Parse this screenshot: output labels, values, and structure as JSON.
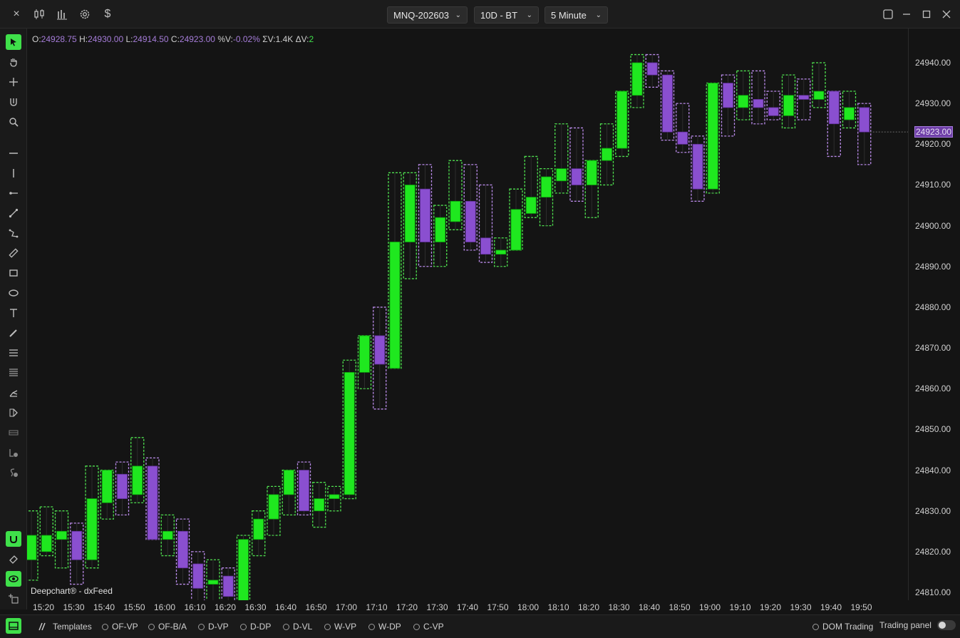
{
  "toolbar": {
    "close_icon": "×",
    "dollar_icon": "$",
    "symbol": "MNQ-202603",
    "period": "10D - BT",
    "interval": "5 Minute"
  },
  "ohlc": {
    "o_label": "O:",
    "o_value": "24928.75",
    "h_label": "H:",
    "h_value": "24930.00",
    "l_label": "L:",
    "l_value": "24914.50",
    "c_label": "C:",
    "c_value": "24923.00",
    "pv_label": "%V:",
    "pv_value": "-0.02%",
    "sv_label": "ΣV:",
    "sv_value": "1.4K",
    "dv_label": "ΔV:",
    "dv_value": "2"
  },
  "watermark": "Deepchart® - dxFeed",
  "current_price": "24923.00",
  "colors": {
    "up": "#1fe81f",
    "down": "#8a4fd0",
    "accent": "#3fe04a"
  },
  "price_ticks": [
    "24940.00",
    "24930.00",
    "24920.00",
    "24910.00",
    "24900.00",
    "24890.00",
    "24880.00",
    "24870.00",
    "24860.00",
    "24850.00",
    "24840.00",
    "24830.00",
    "24820.00",
    "24810.00"
  ],
  "time_ticks": [
    "15:20",
    "15:30",
    "15:40",
    "15:50",
    "16:00",
    "16:10",
    "16:20",
    "16:30",
    "16:40",
    "16:50",
    "17:00",
    "17:10",
    "17:20",
    "17:30",
    "17:40",
    "17:50",
    "18:00",
    "18:10",
    "18:20",
    "18:30",
    "18:40",
    "18:50",
    "19:00",
    "19:10",
    "19:20",
    "19:30",
    "19:40",
    "19:50"
  ],
  "bottom": {
    "templates": "Templates",
    "options": [
      "OF-VP",
      "OF-B/A",
      "D-VP",
      "D-DP",
      "D-VL",
      "W-VP",
      "W-DP",
      "C-VP"
    ],
    "dom_trading": "DOM Trading",
    "trading_panel": "Trading panel"
  },
  "chart_data": {
    "type": "candlestick",
    "symbol": "MNQ-202603",
    "interval": "5 Minute",
    "y_range": [
      24808,
      24948
    ],
    "candles": [
      {
        "t": "15:15",
        "o": 24818,
        "c": 24824,
        "h": 24830,
        "l": 24813
      },
      {
        "t": "15:17",
        "o": 24820,
        "c": 24824,
        "h": 24831,
        "l": 24819
      },
      {
        "t": "15:20",
        "o": 24823,
        "c": 24825,
        "h": 24830,
        "l": 24816
      },
      {
        "t": "15:25",
        "o": 24825,
        "c": 24818,
        "h": 24827,
        "l": 24812
      },
      {
        "t": "15:30",
        "o": 24818,
        "c": 24833,
        "h": 24841,
        "l": 24816
      },
      {
        "t": "15:35",
        "o": 24832,
        "c": 24840,
        "h": 24840,
        "l": 24828
      },
      {
        "t": "15:40",
        "o": 24839,
        "c": 24833,
        "h": 24842,
        "l": 24829
      },
      {
        "t": "15:45",
        "o": 24834,
        "c": 24841,
        "h": 24848,
        "l": 24832
      },
      {
        "t": "15:50",
        "o": 24841,
        "c": 24823,
        "h": 24843,
        "l": 24823
      },
      {
        "t": "15:55",
        "o": 24823,
        "c": 24825,
        "h": 24829,
        "l": 24819
      },
      {
        "t": "16:00",
        "o": 24825,
        "c": 24816,
        "h": 24828,
        "l": 24812
      },
      {
        "t": "16:05",
        "o": 24817,
        "c": 24811,
        "h": 24820,
        "l": 24806
      },
      {
        "t": "16:10",
        "o": 24812,
        "c": 24813,
        "h": 24818,
        "l": 24805
      },
      {
        "t": "16:15",
        "o": 24814,
        "c": 24809,
        "h": 24816,
        "l": 24804
      },
      {
        "t": "16:20",
        "o": 24807,
        "c": 24823,
        "h": 24824,
        "l": 24804
      },
      {
        "t": "16:25",
        "o": 24823,
        "c": 24828,
        "h": 24830,
        "l": 24819
      },
      {
        "t": "16:30",
        "o": 24828,
        "c": 24834,
        "h": 24836,
        "l": 24824
      },
      {
        "t": "16:35",
        "o": 24834,
        "c": 24840,
        "h": 24840,
        "l": 24829
      },
      {
        "t": "16:40",
        "o": 24840,
        "c": 24830,
        "h": 24842,
        "l": 24829
      },
      {
        "t": "16:45",
        "o": 24830,
        "c": 24833,
        "h": 24837,
        "l": 24826
      },
      {
        "t": "16:50",
        "o": 24833,
        "c": 24834,
        "h": 24836,
        "l": 24830
      },
      {
        "t": "16:55",
        "o": 24834,
        "c": 24864,
        "h": 24867,
        "l": 24833
      },
      {
        "t": "17:00",
        "o": 24864,
        "c": 24873,
        "h": 24873,
        "l": 24860
      },
      {
        "t": "17:05",
        "o": 24873,
        "c": 24866,
        "h": 24880,
        "l": 24855
      },
      {
        "t": "17:10",
        "o": 24865,
        "c": 24896,
        "h": 24913,
        "l": 24865
      },
      {
        "t": "17:15",
        "o": 24896,
        "c": 24910,
        "h": 24913,
        "l": 24887
      },
      {
        "t": "17:20",
        "o": 24909,
        "c": 24896,
        "h": 24915,
        "l": 24890
      },
      {
        "t": "17:25",
        "o": 24896,
        "c": 24902,
        "h": 24905,
        "l": 24890
      },
      {
        "t": "17:30",
        "o": 24901,
        "c": 24906,
        "h": 24916,
        "l": 24899
      },
      {
        "t": "17:35",
        "o": 24906,
        "c": 24896,
        "h": 24915,
        "l": 24894
      },
      {
        "t": "17:40",
        "o": 24897,
        "c": 24893,
        "h": 24910,
        "l": 24891
      },
      {
        "t": "17:45",
        "o": 24893,
        "c": 24894,
        "h": 24897,
        "l": 24890
      },
      {
        "t": "17:50",
        "o": 24894,
        "c": 24904,
        "h": 24909,
        "l": 24894
      },
      {
        "t": "17:55",
        "o": 24903,
        "c": 24907,
        "h": 24917,
        "l": 24902
      },
      {
        "t": "18:00",
        "o": 24907,
        "c": 24912,
        "h": 24914,
        "l": 24900
      },
      {
        "t": "18:05",
        "o": 24911,
        "c": 24914,
        "h": 24925,
        "l": 24908
      },
      {
        "t": "18:10",
        "o": 24914,
        "c": 24910,
        "h": 24924,
        "l": 24906
      },
      {
        "t": "18:15",
        "o": 24910,
        "c": 24916,
        "h": 24916,
        "l": 24902
      },
      {
        "t": "18:20",
        "o": 24916,
        "c": 24919,
        "h": 24925,
        "l": 24910
      },
      {
        "t": "18:25",
        "o": 24919,
        "c": 24933,
        "h": 24933,
        "l": 24917
      },
      {
        "t": "18:30",
        "o": 24932,
        "c": 24940,
        "h": 24942,
        "l": 24929
      },
      {
        "t": "18:35",
        "o": 24940,
        "c": 24937,
        "h": 24942,
        "l": 24934
      },
      {
        "t": "18:40",
        "o": 24937,
        "c": 24923,
        "h": 24938,
        "l": 24921
      },
      {
        "t": "18:45",
        "o": 24923,
        "c": 24920,
        "h": 24930,
        "l": 24918
      },
      {
        "t": "18:50",
        "o": 24920,
        "c": 24909,
        "h": 24922,
        "l": 24906
      },
      {
        "t": "18:55",
        "o": 24909,
        "c": 24935,
        "h": 24935,
        "l": 24908
      },
      {
        "t": "19:00",
        "o": 24935,
        "c": 24929,
        "h": 24937,
        "l": 24922
      },
      {
        "t": "19:05",
        "o": 24929,
        "c": 24932,
        "h": 24938,
        "l": 24926
      },
      {
        "t": "19:10",
        "o": 24931,
        "c": 24929,
        "h": 24938,
        "l": 24925
      },
      {
        "t": "19:15",
        "o": 24929,
        "c": 24927,
        "h": 24933,
        "l": 24926
      },
      {
        "t": "19:20",
        "o": 24927,
        "c": 24932,
        "h": 24937,
        "l": 24924
      },
      {
        "t": "19:25",
        "o": 24932,
        "c": 24931,
        "h": 24936,
        "l": 24926
      },
      {
        "t": "19:30",
        "o": 24931,
        "c": 24933,
        "h": 24940,
        "l": 24929
      },
      {
        "t": "19:35",
        "o": 24933,
        "c": 24925,
        "h": 24933,
        "l": 24917
      },
      {
        "t": "19:40",
        "o": 24926,
        "c": 24929,
        "h": 24933,
        "l": 24924
      },
      {
        "t": "19:45",
        "o": 24929,
        "c": 24923,
        "h": 24930,
        "l": 24915
      }
    ]
  }
}
